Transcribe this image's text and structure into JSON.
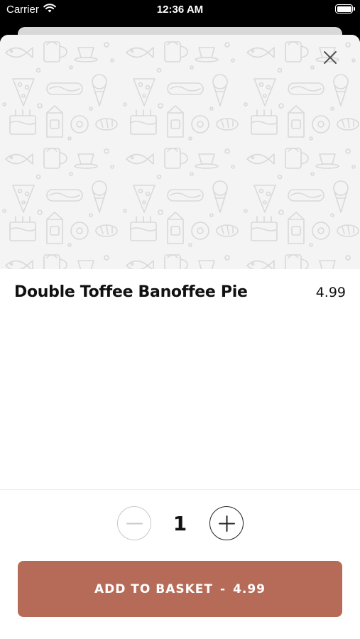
{
  "status_bar": {
    "carrier": "Carrier",
    "time": "12:36 AM",
    "wifi_icon": "wifi-icon",
    "battery_icon": "battery-icon"
  },
  "product": {
    "name": "Double Toffee Banoffee Pie",
    "price": "4.99",
    "hero_pattern": "food-doodle-pattern"
  },
  "quantity": {
    "value": "1",
    "minus_icon": "minus-icon",
    "plus_icon": "plus-icon"
  },
  "add_button": {
    "label": "ADD TO BASKET",
    "separator": "-",
    "price": "4.99"
  },
  "colors": {
    "accent": "#b66b59",
    "hero_background": "#f4f4f4"
  }
}
